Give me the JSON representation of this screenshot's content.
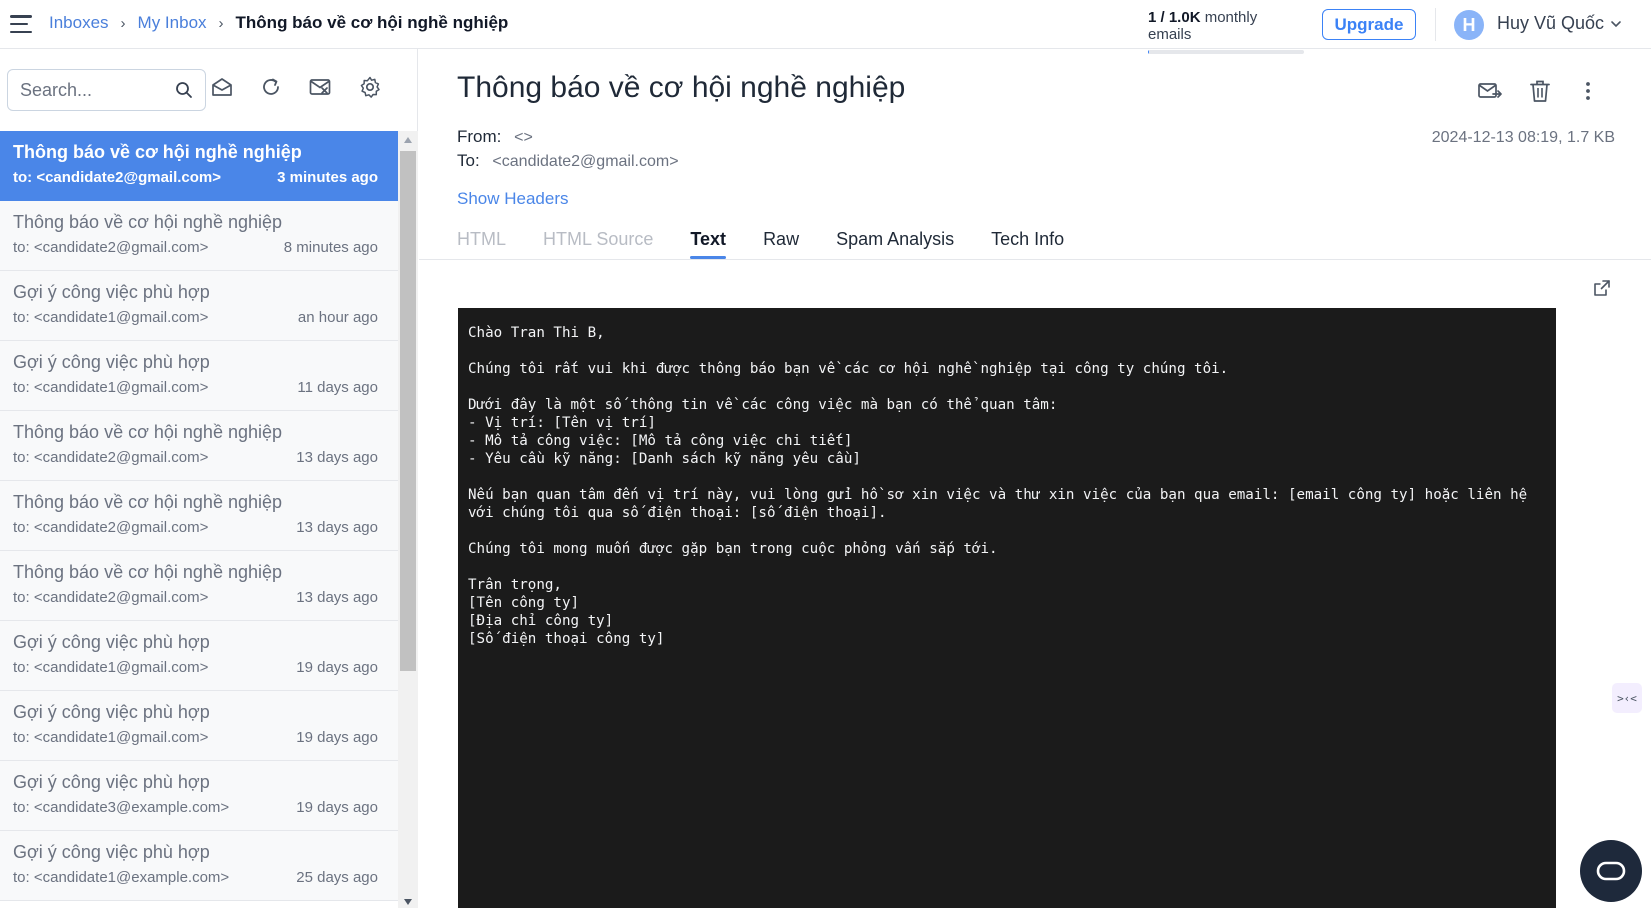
{
  "header": {
    "breadcrumb": [
      "Inboxes",
      "My Inbox"
    ],
    "current_page": "Thông báo về cơ hội nghề nghiệp",
    "usage_count": "1 / 1.0K",
    "usage_label": "monthly emails",
    "usage_fraction": 0.001,
    "upgrade_label": "Upgrade",
    "avatar_initial": "H",
    "user_name": "Huy Vũ Quốc"
  },
  "sidebar": {
    "search_placeholder": "Search...",
    "toolbar_icons": [
      "mark-read-icon",
      "refresh-icon",
      "clear-inbox-icon",
      "settings-icon"
    ],
    "emails": [
      {
        "subject": "Thông báo về cơ hội nghề nghiệp",
        "to": "to: <candidate2@gmail.com>",
        "time": "3 minutes ago",
        "active": true
      },
      {
        "subject": "Thông báo về cơ hội nghề nghiệp",
        "to": "to: <candidate2@gmail.com>",
        "time": "8 minutes ago"
      },
      {
        "subject": "Gợi ý công việc phù hợp",
        "to": "to: <candidate1@gmail.com>",
        "time": "an hour ago"
      },
      {
        "subject": "Gợi ý công việc phù hợp",
        "to": "to: <candidate1@gmail.com>",
        "time": "11 days ago"
      },
      {
        "subject": "Thông báo về cơ hội nghề nghiệp",
        "to": "to: <candidate2@gmail.com>",
        "time": "13 days ago"
      },
      {
        "subject": "Thông báo về cơ hội nghề nghiệp",
        "to": "to: <candidate2@gmail.com>",
        "time": "13 days ago"
      },
      {
        "subject": "Thông báo về cơ hội nghề nghiệp",
        "to": "to: <candidate2@gmail.com>",
        "time": "13 days ago"
      },
      {
        "subject": "Gợi ý công việc phù hợp",
        "to": "to: <candidate1@gmail.com>",
        "time": "19 days ago"
      },
      {
        "subject": "Gợi ý công việc phù hợp",
        "to": "to: <candidate1@gmail.com>",
        "time": "19 days ago"
      },
      {
        "subject": "Gợi ý công việc phù hợp",
        "to": "to: <candidate3@example.com>",
        "time": "19 days ago"
      },
      {
        "subject": "Gợi ý công việc phù hợp",
        "to": "to: <candidate1@example.com>",
        "time": "25 days ago"
      }
    ]
  },
  "message": {
    "title": "Thông báo về cơ hội nghề nghiệp",
    "from_label": "From:",
    "from_value": "<>",
    "to_label": "To:",
    "to_value": "<candidate2@gmail.com>",
    "date_size": "2024-12-13 08:19, 1.7 KB",
    "show_headers": "Show Headers",
    "tabs": [
      {
        "label": "HTML",
        "state": "disabled"
      },
      {
        "label": "HTML Source",
        "state": "disabled"
      },
      {
        "label": "Text",
        "state": "selected"
      },
      {
        "label": "Raw",
        "state": "normal"
      },
      {
        "label": "Spam Analysis",
        "state": "normal"
      },
      {
        "label": "Tech Info",
        "state": "normal"
      }
    ],
    "body_text": "Chào Tran Thi B,\n\nChúng tôi rất vui khi được thông báo bạn về các cơ hội nghề nghiệp tại công ty chúng tôi.\n\nDưới đây là một số thông tin về các công việc mà bạn có thể quan tâm:\n- Vị trí: [Tên vị trí]\n- Mô tả công việc: [Mô tả công việc chi tiết]\n- Yêu cầu kỹ năng: [Danh sách kỹ năng yêu cầu]\n\nNếu bạn quan tâm đến vị trí này, vui lòng gửi hồ sơ xin việc và thư xin việc của bạn qua email: [email công ty] hoặc liên hệ\nvới chúng tôi qua số điện thoại: [số điện thoại].\n\nChúng tôi mong muốn được gặp bạn trong cuộc phỏng vấn sắp tới.\n\nTrân trọng,\n[Tên công ty]\n[Địa chỉ công ty]\n[Số điện thoại công ty]"
  },
  "widgets": {
    "side_widget_glyph": ">‹<"
  },
  "colors": {
    "accent": "#4a86e8",
    "active_item_bg": "#4a86e8",
    "text_panel_bg": "#1b1b1b"
  }
}
